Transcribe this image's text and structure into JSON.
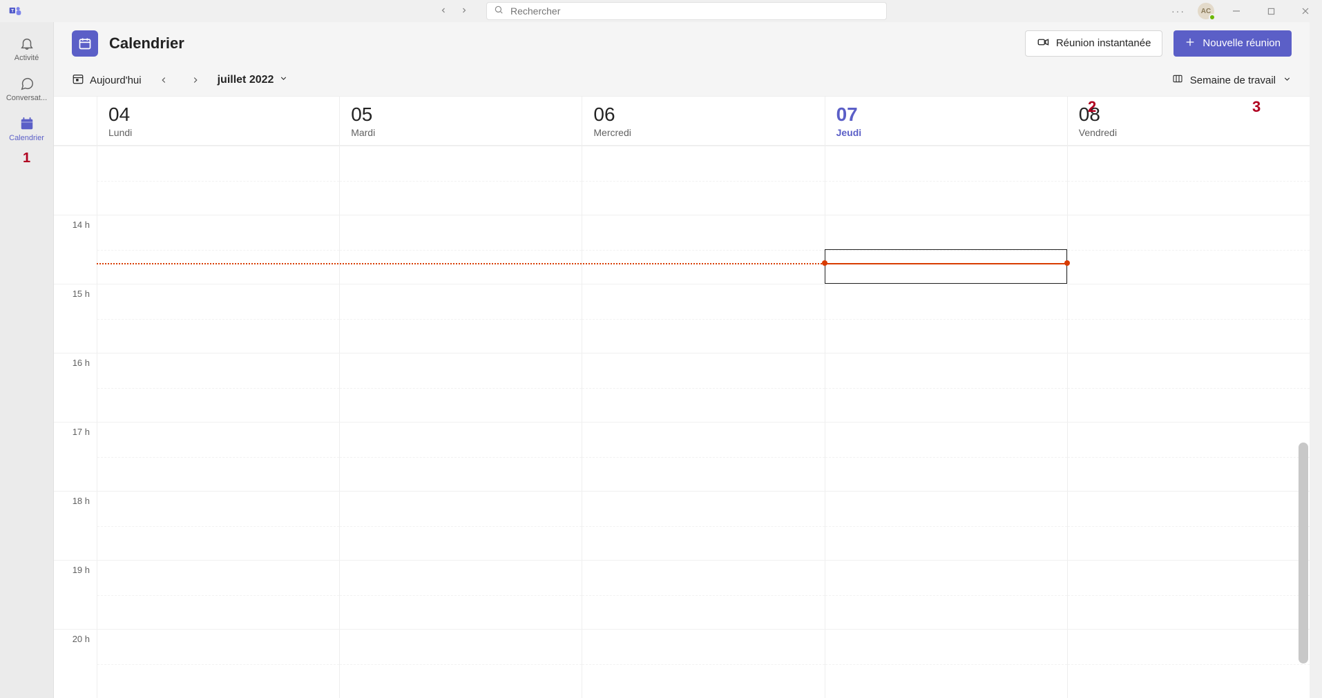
{
  "titlebar": {
    "search_placeholder": "Rechercher",
    "avatar_initials": "AC"
  },
  "rail": {
    "items": [
      {
        "label": "Activité"
      },
      {
        "label": "Conversat..."
      },
      {
        "label": "Calendrier"
      }
    ]
  },
  "header": {
    "page_title": "Calendrier",
    "meet_now_label": "Réunion instantanée",
    "new_meeting_label": "Nouvelle réunion"
  },
  "toolbar": {
    "today_label": "Aujourd'hui",
    "month_label": "juillet 2022",
    "view_label": "Semaine de travail"
  },
  "annotations": {
    "a1": "1",
    "a2": "2",
    "a3": "3"
  },
  "days": [
    {
      "num": "04",
      "name": "Lundi",
      "today": false
    },
    {
      "num": "05",
      "name": "Mardi",
      "today": false
    },
    {
      "num": "06",
      "name": "Mercredi",
      "today": false
    },
    {
      "num": "07",
      "name": "Jeudi",
      "today": true
    },
    {
      "num": "08",
      "name": "Vendredi",
      "today": false
    }
  ],
  "hours": [
    "",
    "14 h",
    "15 h",
    "16 h",
    "17 h",
    "18 h",
    "19 h",
    "20 h"
  ],
  "now": {
    "hour_index": 1,
    "fraction": 0.7
  },
  "selected_slot": {
    "day_index": 3,
    "hour_index": 1,
    "half": 1
  },
  "colors": {
    "accent": "#5b5fc7",
    "danger": "#d83b01"
  }
}
